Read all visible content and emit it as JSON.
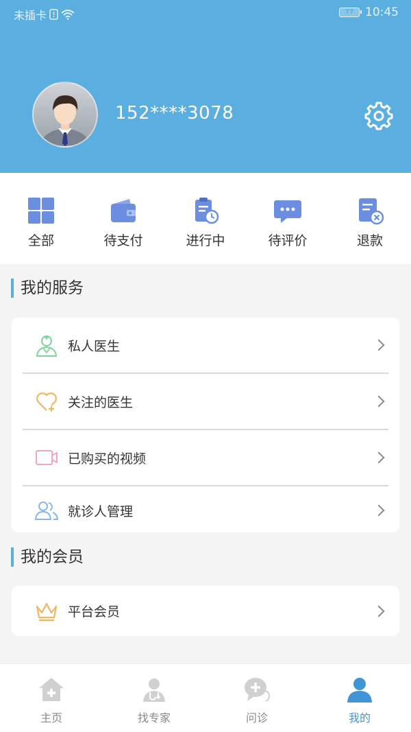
{
  "status_bar": {
    "carrier": "未插卡",
    "battery": "77",
    "time": "10:45"
  },
  "profile": {
    "phone": "152****3078"
  },
  "orders": [
    {
      "label": "全部",
      "icon": "grid-icon"
    },
    {
      "label": "待支付",
      "icon": "wallet-icon"
    },
    {
      "label": "进行中",
      "icon": "clipboard-clock-icon"
    },
    {
      "label": "待评价",
      "icon": "chat-bubble-icon"
    },
    {
      "label": "退款",
      "icon": "refund-doc-icon"
    }
  ],
  "services": {
    "title": "我的服务",
    "items": [
      {
        "label": "私人医生",
        "icon": "doctor-icon"
      },
      {
        "label": "关注的医生",
        "icon": "heart-plus-icon"
      },
      {
        "label": "已购买的视频",
        "icon": "video-icon"
      },
      {
        "label": "就诊人管理",
        "icon": "users-icon"
      }
    ]
  },
  "membership": {
    "title": "我的会员",
    "items": [
      {
        "label": "平台会员",
        "icon": "crown-icon"
      }
    ]
  },
  "tabbar": [
    {
      "label": "主页",
      "icon": "home-icon"
    },
    {
      "label": "找专家",
      "icon": "expert-icon"
    },
    {
      "label": "问诊",
      "icon": "consult-icon"
    },
    {
      "label": "我的",
      "icon": "profile-icon",
      "active": true
    }
  ],
  "colors": {
    "header": "#5aaee0",
    "accent": "#3f95d6",
    "order_icon": "#6c8ee0"
  }
}
